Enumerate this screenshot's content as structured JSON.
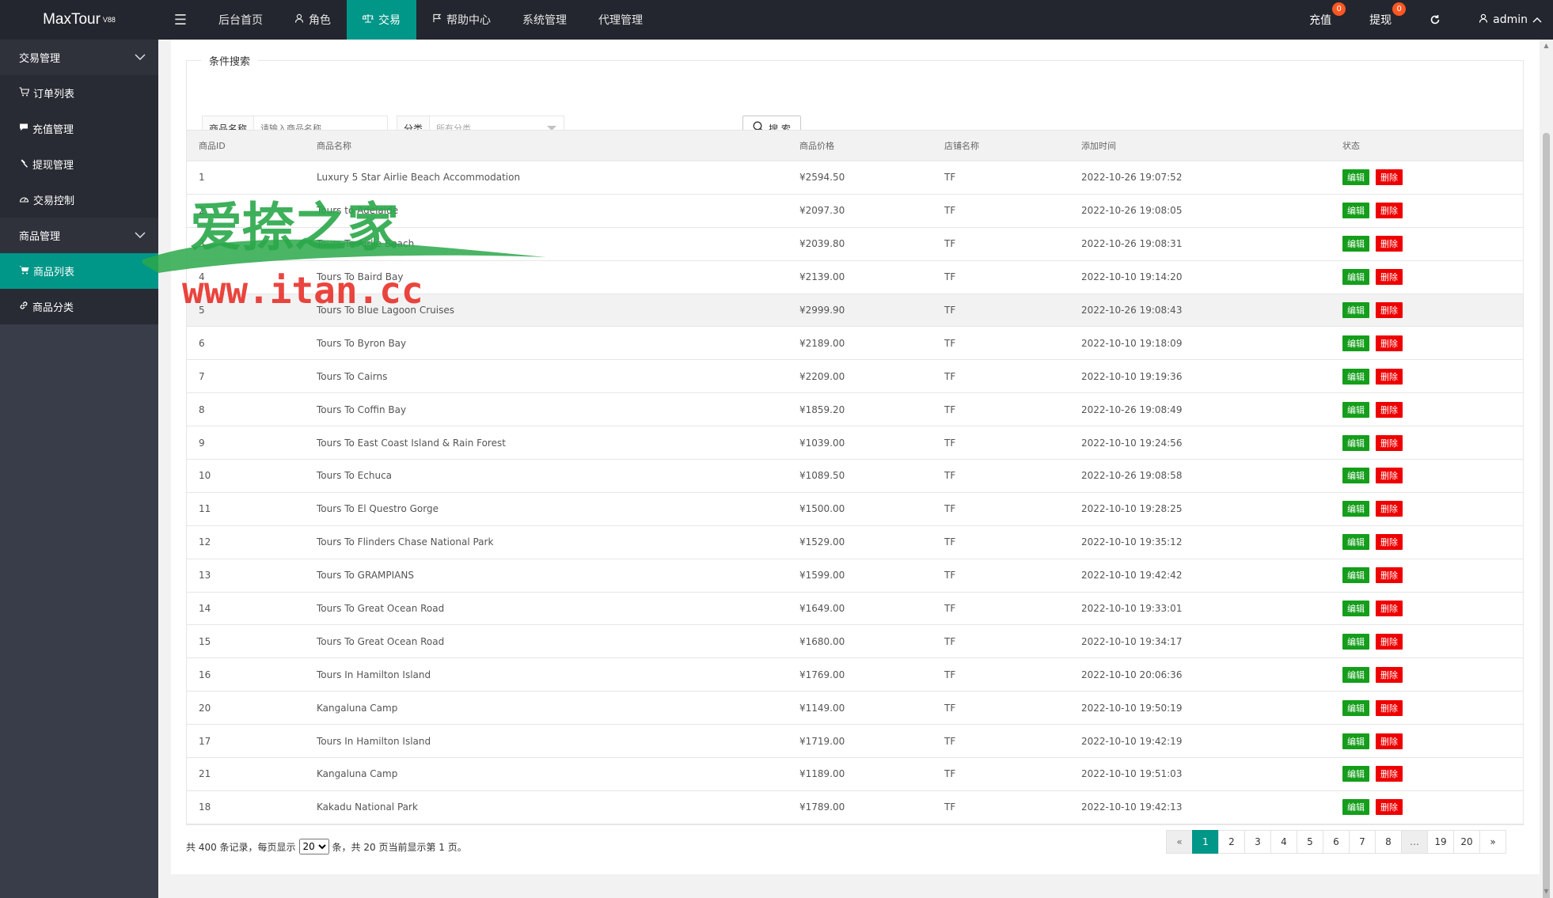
{
  "header": {
    "logo": "MaxTour",
    "logo_sup": "V88",
    "nav": [
      {
        "label": "后台首页",
        "icon": ""
      },
      {
        "label": "角色",
        "icon": "user-icon"
      },
      {
        "label": "交易",
        "icon": "scale-icon"
      },
      {
        "label": "帮助中心",
        "icon": "flag-icon"
      },
      {
        "label": "系统管理",
        "icon": ""
      },
      {
        "label": "代理管理",
        "icon": ""
      }
    ],
    "right": {
      "recharge": "充值",
      "recharge_badge": "0",
      "withdraw": "提现",
      "withdraw_badge": "0",
      "user": "admin"
    }
  },
  "sidebar": {
    "group1": "交易管理",
    "items1": [
      {
        "label": "订单列表",
        "icon": "cart-icon"
      },
      {
        "label": "充值管理",
        "icon": "chat-icon"
      },
      {
        "label": "提现管理",
        "icon": "hammer-icon"
      },
      {
        "label": "交易控制",
        "icon": "dashboard-icon"
      }
    ],
    "group2": "商品管理",
    "items2": [
      {
        "label": "商品列表",
        "icon": "cart-icon"
      },
      {
        "label": "商品分类",
        "icon": "link-icon"
      }
    ]
  },
  "search": {
    "legend": "条件搜索",
    "name_label": "商品名称",
    "name_placeholder": "请输入商品名称",
    "cat_label": "分类",
    "cat_value": "所有分类",
    "button": "搜 索"
  },
  "table": {
    "headers": [
      "商品ID",
      "商品名称",
      "商品价格",
      "店铺名称",
      "添加时间",
      "状态"
    ],
    "edit_label": "编辑",
    "delete_label": "删除",
    "rows": [
      {
        "id": "1",
        "name": "Luxury 5 Star Airlie Beach Accommodation",
        "price": "¥2594.50",
        "shop": "TF",
        "time": "2022-10-26 19:07:52"
      },
      {
        "id": "2",
        "name": "Tours to Adelaide",
        "price": "¥2097.30",
        "shop": "TF",
        "time": "2022-10-26 19:08:05"
      },
      {
        "id": "3",
        "name": "Tours To Airlie Beach",
        "price": "¥2039.80",
        "shop": "TF",
        "time": "2022-10-26 19:08:31"
      },
      {
        "id": "4",
        "name": "Tours To Baird Bay",
        "price": "¥2139.00",
        "shop": "TF",
        "time": "2022-10-10 19:14:20"
      },
      {
        "id": "5",
        "name": "Tours To Blue Lagoon Cruises",
        "price": "¥2999.90",
        "shop": "TF",
        "time": "2022-10-26 19:08:43"
      },
      {
        "id": "6",
        "name": "Tours To Byron Bay",
        "price": "¥2189.00",
        "shop": "TF",
        "time": "2022-10-10 19:18:09"
      },
      {
        "id": "7",
        "name": "Tours To Cairns",
        "price": "¥2209.00",
        "shop": "TF",
        "time": "2022-10-10 19:19:36"
      },
      {
        "id": "8",
        "name": "Tours To Coffin Bay",
        "price": "¥1859.20",
        "shop": "TF",
        "time": "2022-10-26 19:08:49"
      },
      {
        "id": "9",
        "name": "Tours To East Coast Island & Rain Forest",
        "price": "¥1039.00",
        "shop": "TF",
        "time": "2022-10-10 19:24:56"
      },
      {
        "id": "10",
        "name": "Tours To Echuca",
        "price": "¥1089.50",
        "shop": "TF",
        "time": "2022-10-26 19:08:58"
      },
      {
        "id": "11",
        "name": "Tours To El Questro Gorge",
        "price": "¥1500.00",
        "shop": "TF",
        "time": "2022-10-10 19:28:25"
      },
      {
        "id": "12",
        "name": "Tours To Flinders Chase National Park",
        "price": "¥1529.00",
        "shop": "TF",
        "time": "2022-10-10 19:35:12"
      },
      {
        "id": "13",
        "name": "Tours To GRAMPIANS",
        "price": "¥1599.00",
        "shop": "TF",
        "time": "2022-10-10 19:42:42"
      },
      {
        "id": "14",
        "name": "Tours To Great Ocean Road",
        "price": "¥1649.00",
        "shop": "TF",
        "time": "2022-10-10 19:33:01"
      },
      {
        "id": "15",
        "name": "Tours To Great Ocean Road",
        "price": "¥1680.00",
        "shop": "TF",
        "time": "2022-10-10 19:34:17"
      },
      {
        "id": "16",
        "name": "Tours In Hamilton Island",
        "price": "¥1769.00",
        "shop": "TF",
        "time": "2022-10-10 20:06:36"
      },
      {
        "id": "20",
        "name": "Kangaluna Camp",
        "price": "¥1149.00",
        "shop": "TF",
        "time": "2022-10-10 19:50:19"
      },
      {
        "id": "17",
        "name": "Tours In Hamilton Island",
        "price": "¥1719.00",
        "shop": "TF",
        "time": "2022-10-10 19:42:19"
      },
      {
        "id": "21",
        "name": "Kangaluna Camp",
        "price": "¥1189.00",
        "shop": "TF",
        "time": "2022-10-10 19:51:03"
      },
      {
        "id": "18",
        "name": "Kakadu National Park",
        "price": "¥1789.00",
        "shop": "TF",
        "time": "2022-10-10 19:42:13"
      }
    ]
  },
  "footer": {
    "prefix": "共 400 条记录，每页显示",
    "page_size": "20",
    "suffix": "条，共 20 页当前显示第 1 页。",
    "pages": [
      "«",
      "1",
      "2",
      "3",
      "4",
      "5",
      "6",
      "7",
      "8",
      "…",
      "19",
      "20",
      "»"
    ],
    "current_page": "1"
  },
  "watermark": {
    "line1": "爱捺之家",
    "line2": "www.itan.cc"
  },
  "colors": {
    "accent": "#009688",
    "header_bg": "#23262e",
    "sidebar_bg": "#393d49",
    "edit": "#159e1b",
    "delete": "#ef0000",
    "watermark": "#2aa84a"
  }
}
